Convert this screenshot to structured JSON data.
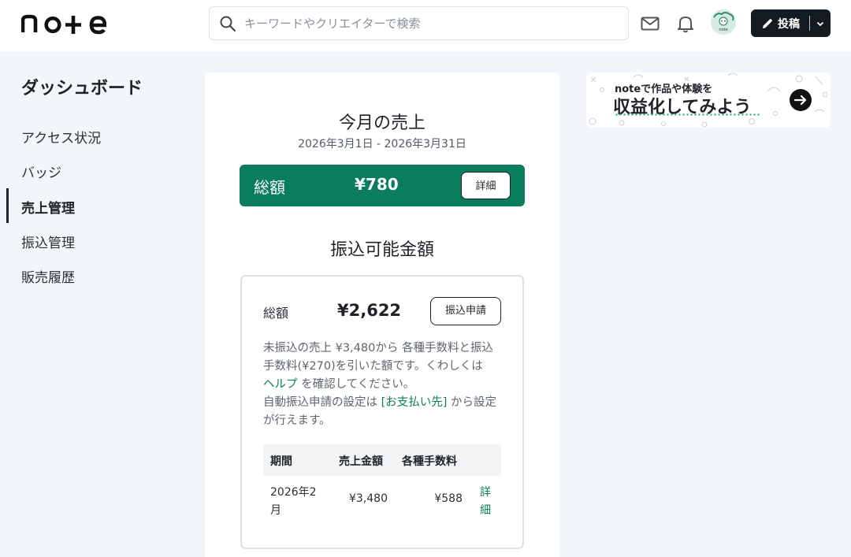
{
  "header": {
    "logo": "note",
    "search_placeholder": "キーワードやクリエイターで検索",
    "avatar_text": "note",
    "post_label": "投稿"
  },
  "sidebar": {
    "title": "ダッシュボード",
    "items": [
      {
        "label": "アクセス状況",
        "active": false
      },
      {
        "label": "バッジ",
        "active": false
      },
      {
        "label": "売上管理",
        "active": true
      },
      {
        "label": "振込管理",
        "active": false
      },
      {
        "label": "販売履歴",
        "active": false
      }
    ]
  },
  "sales": {
    "title": "今月の売上",
    "range": "2026年3月1日 - 2026年3月31日",
    "total_label": "総額",
    "total_amount": "¥780",
    "detail_label": "詳細"
  },
  "transfer": {
    "title": "振込可能金額",
    "total_label": "総額",
    "total_amount": "¥2,622",
    "apply_label": "振込申請",
    "desc_1": "未振込の売上 ¥3,480から 各種手数料と振込手数料(¥270)を引いた額です。くわしくは",
    "desc_help": "ヘルプ",
    "desc_2": " を確認してください。",
    "desc_3": "自動振込申請の設定は ",
    "desc_payee": "[お支払い先]",
    "desc_4": " から設定が行えます。",
    "table": {
      "headers": [
        "期間",
        "売上金額",
        "各種手数料"
      ],
      "rows": [
        {
          "period": "2026年2月",
          "sales": "¥3,480",
          "fee": "¥588",
          "link": "詳細"
        }
      ]
    }
  },
  "banner": {
    "line1": "noteで作品や体験を",
    "line2": "収益化してみよう"
  },
  "colors": {
    "accent": "#0a7d5c",
    "header_bg": "#ffffff",
    "page_bg": "#f2f5f9",
    "post_button": "#131a20"
  }
}
